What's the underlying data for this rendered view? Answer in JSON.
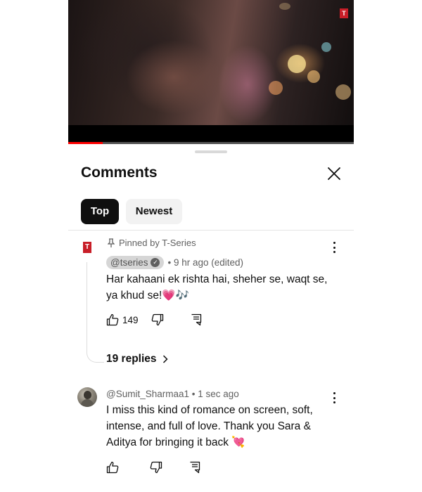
{
  "video": {
    "progress_fraction": 0.12,
    "watermark": "T"
  },
  "comments_panel": {
    "title": "Comments",
    "close_icon": "close-icon",
    "sort_chips": [
      {
        "label": "Top",
        "selected": true
      },
      {
        "label": "Newest",
        "selected": false
      }
    ]
  },
  "pinned_comment": {
    "avatar_text": "T",
    "pinned_label": "Pinned by T-Series",
    "handle": "@tseries",
    "time": "• 9 hr ago (edited)",
    "text_line1": "Har kahaani ek rishta hai, sheher se, waqt se,",
    "text_line2": "ya khud se!💗🎶",
    "like_count": "149",
    "replies_label": "19 replies"
  },
  "user_comment": {
    "meta": "@Sumit_Sharmaa1 • 1 sec ago",
    "text_line1": "I miss this kind of romance on screen, soft,",
    "text_line2": "intense, and full of love. Thank you Sara &",
    "text_line3": "Aditya for bringing it back 💘"
  },
  "colors": {
    "accent_red": "#ff0000",
    "brand_tseries": "#c81e28",
    "chip_selected": "#0f0f0f",
    "chip_unselected": "#f2f2f2",
    "secondary_text": "#606060"
  }
}
